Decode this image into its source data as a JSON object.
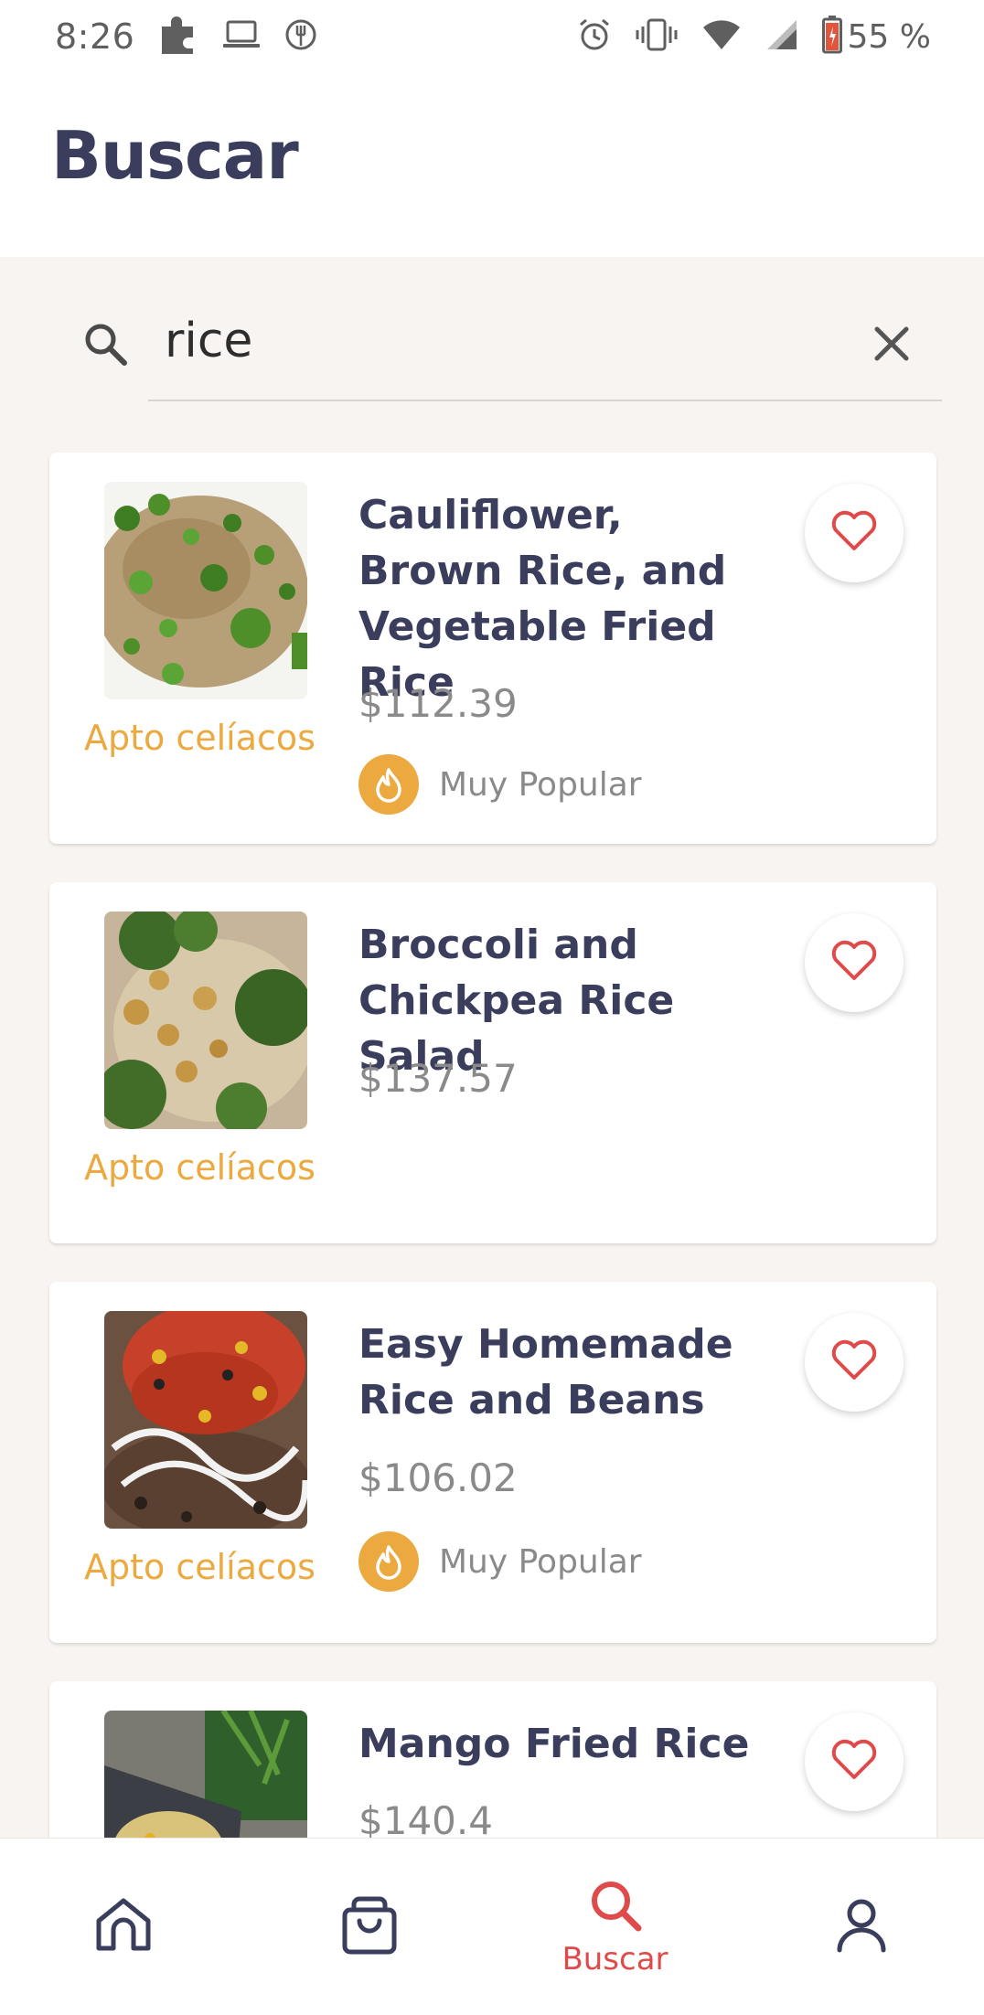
{
  "status_bar": {
    "time": "8:26",
    "battery_percent": "55 %",
    "left_icons": [
      "puzzle-icon",
      "laptop-icon",
      "fork-circle-icon"
    ],
    "right_icons": [
      "alarm-icon",
      "vibrate-icon",
      "wifi-icon",
      "signal-icon",
      "battery-icon"
    ]
  },
  "header": {
    "title": "Buscar"
  },
  "search": {
    "query": "rice",
    "icon": "search-icon",
    "clear_icon": "close-icon"
  },
  "results": [
    {
      "title": "Cauliflower, Brown Rice, and Vegetable Fried Rice",
      "price": "$112.39",
      "celiac_label": "Apto celíacos",
      "popular_label": "Muy Popular",
      "favorite_icon": "heart-outline-icon"
    },
    {
      "title": "Broccoli and Chickpea Rice Salad",
      "price": "$137.57",
      "celiac_label": "Apto celíacos",
      "favorite_icon": "heart-outline-icon"
    },
    {
      "title": "Easy Homemade Rice and Beans",
      "price": "$106.02",
      "celiac_label": "Apto celíacos",
      "popular_label": "Muy Popular",
      "favorite_icon": "heart-outline-icon"
    },
    {
      "title": "Mango Fried Rice",
      "price": "$140.4",
      "favorite_icon": "heart-outline-icon"
    }
  ],
  "bottom_nav": {
    "items": [
      {
        "icon": "home-icon",
        "label": ""
      },
      {
        "icon": "shopping-bag-icon",
        "label": ""
      },
      {
        "icon": "search-icon",
        "label": "Buscar",
        "active": true
      },
      {
        "icon": "profile-icon",
        "label": ""
      }
    ]
  },
  "colors": {
    "title_text": "#3b3d5c",
    "accent_orange": "#eba93f",
    "accent_red": "#df4b4b",
    "price_gray": "#8a8a8a",
    "background": "#f7f4f1"
  }
}
